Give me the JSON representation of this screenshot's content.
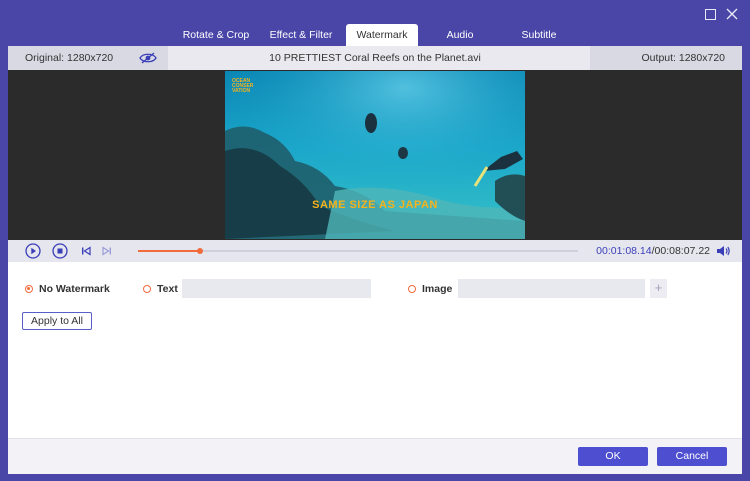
{
  "window": {
    "maximize_icon": "maximize-icon",
    "close_icon": "close-icon"
  },
  "tabs": [
    {
      "label": "Rotate & Crop",
      "active": false
    },
    {
      "label": "Effect & Filter",
      "active": false
    },
    {
      "label": "Watermark",
      "active": true
    },
    {
      "label": "Audio",
      "active": false
    },
    {
      "label": "Subtitle",
      "active": false
    }
  ],
  "infobar": {
    "original": "Original: 1280x720",
    "filename": "10 PRETTIEST Coral Reefs on the Planet.avi",
    "output": "Output: 1280x720",
    "eye_icon": "eye-hidden-icon"
  },
  "video": {
    "logo_text": [
      "OCEAN",
      "CONSER",
      "VATION"
    ],
    "caption": "SAME SIZE AS JAPAN"
  },
  "player": {
    "current_time": "00:01:08.14",
    "duration": "/00:08:07.22",
    "progress": 0.14,
    "icons": [
      "play-icon",
      "stop-icon",
      "skip-back-icon",
      "skip-forward-icon",
      "volume-icon"
    ]
  },
  "watermark": {
    "options": [
      {
        "label": "No Watermark",
        "checked": true
      },
      {
        "label": "Text",
        "checked": false
      },
      {
        "label": "Image",
        "checked": false
      }
    ],
    "text_value": "",
    "image_value": "",
    "add_label": "+",
    "apply_label": "Apply to All"
  },
  "footer": {
    "ok_label": "OK",
    "cancel_label": "Cancel"
  },
  "colors": {
    "accent": "#4e4fd0",
    "frame": "#4a46a8",
    "radio": "#f06a3c",
    "time": "#3a3fb8"
  }
}
